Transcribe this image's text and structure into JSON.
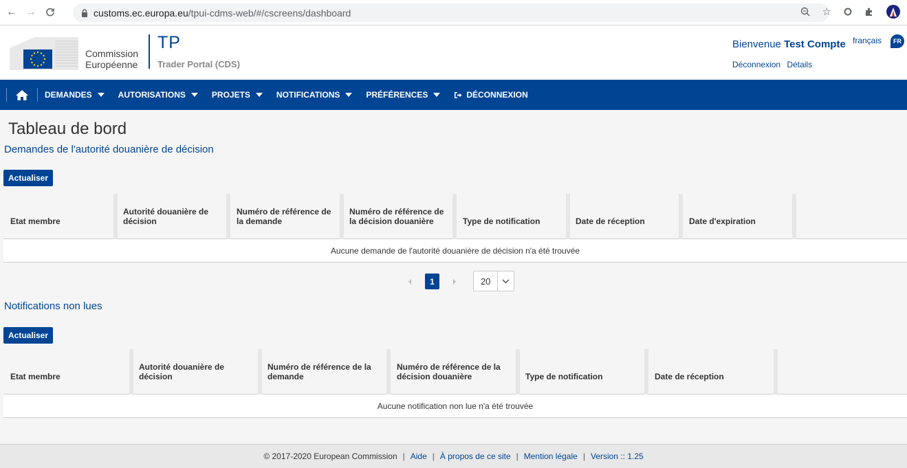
{
  "browser": {
    "url_host": "customs.ec.europa.eu",
    "url_path": "/tpui-cdms-web/#/cscreens/dashboard"
  },
  "header": {
    "commission_line1": "Commission",
    "commission_line2": "Européenne",
    "app_title": "TP",
    "app_subtitle": "Trader Portal (CDS)",
    "welcome_prefix": "Bienvenue",
    "user_name": "Test Compte",
    "language": "français",
    "language_code": "FR",
    "logout_link": "Déconnexion",
    "details_link": "Détails"
  },
  "nav": {
    "items": [
      {
        "label": "DEMANDES",
        "has_dropdown": true
      },
      {
        "label": "AUTORISATIONS",
        "has_dropdown": true
      },
      {
        "label": "PROJETS",
        "has_dropdown": true
      },
      {
        "label": "NOTIFICATIONS",
        "has_dropdown": true
      },
      {
        "label": "PRÉFÉRENCES",
        "has_dropdown": true
      }
    ],
    "logout": "DÉCONNEXION"
  },
  "page": {
    "title": "Tableau de bord"
  },
  "section1": {
    "title": "Demandes de l'autorité douanière de décision",
    "refresh_button": "Actualiser",
    "columns": [
      "Etat membre",
      "Autorité douanière de décision",
      "Numéro de référence de la demande",
      "Numéro de référence de la décision douanière",
      "Type de notification",
      "Date de réception",
      "Date d'expiration"
    ],
    "empty_message": "Aucune demande de l'autorité douanière de décision n'a été trouvée"
  },
  "pagination": {
    "current_page": "1",
    "page_size": "20"
  },
  "section2": {
    "title": "Notifications non lues",
    "refresh_button": "Actualiser",
    "columns": [
      "Etat membre",
      "Autorité douanière de décision",
      "Numéro de référence de la demande",
      "Numéro de référence de la décision douanière",
      "Type de notification",
      "Date de réception"
    ],
    "empty_message": "Aucune notification non lue n'a été trouvée"
  },
  "footer": {
    "copyright": "© 2017-2020 European Commission",
    "help": "Aide",
    "about": "À propos de ce site",
    "legal": "Mention légale",
    "version": "Version :: 1.25"
  },
  "colors": {
    "primary": "#004494",
    "background": "#f5f5f5"
  }
}
